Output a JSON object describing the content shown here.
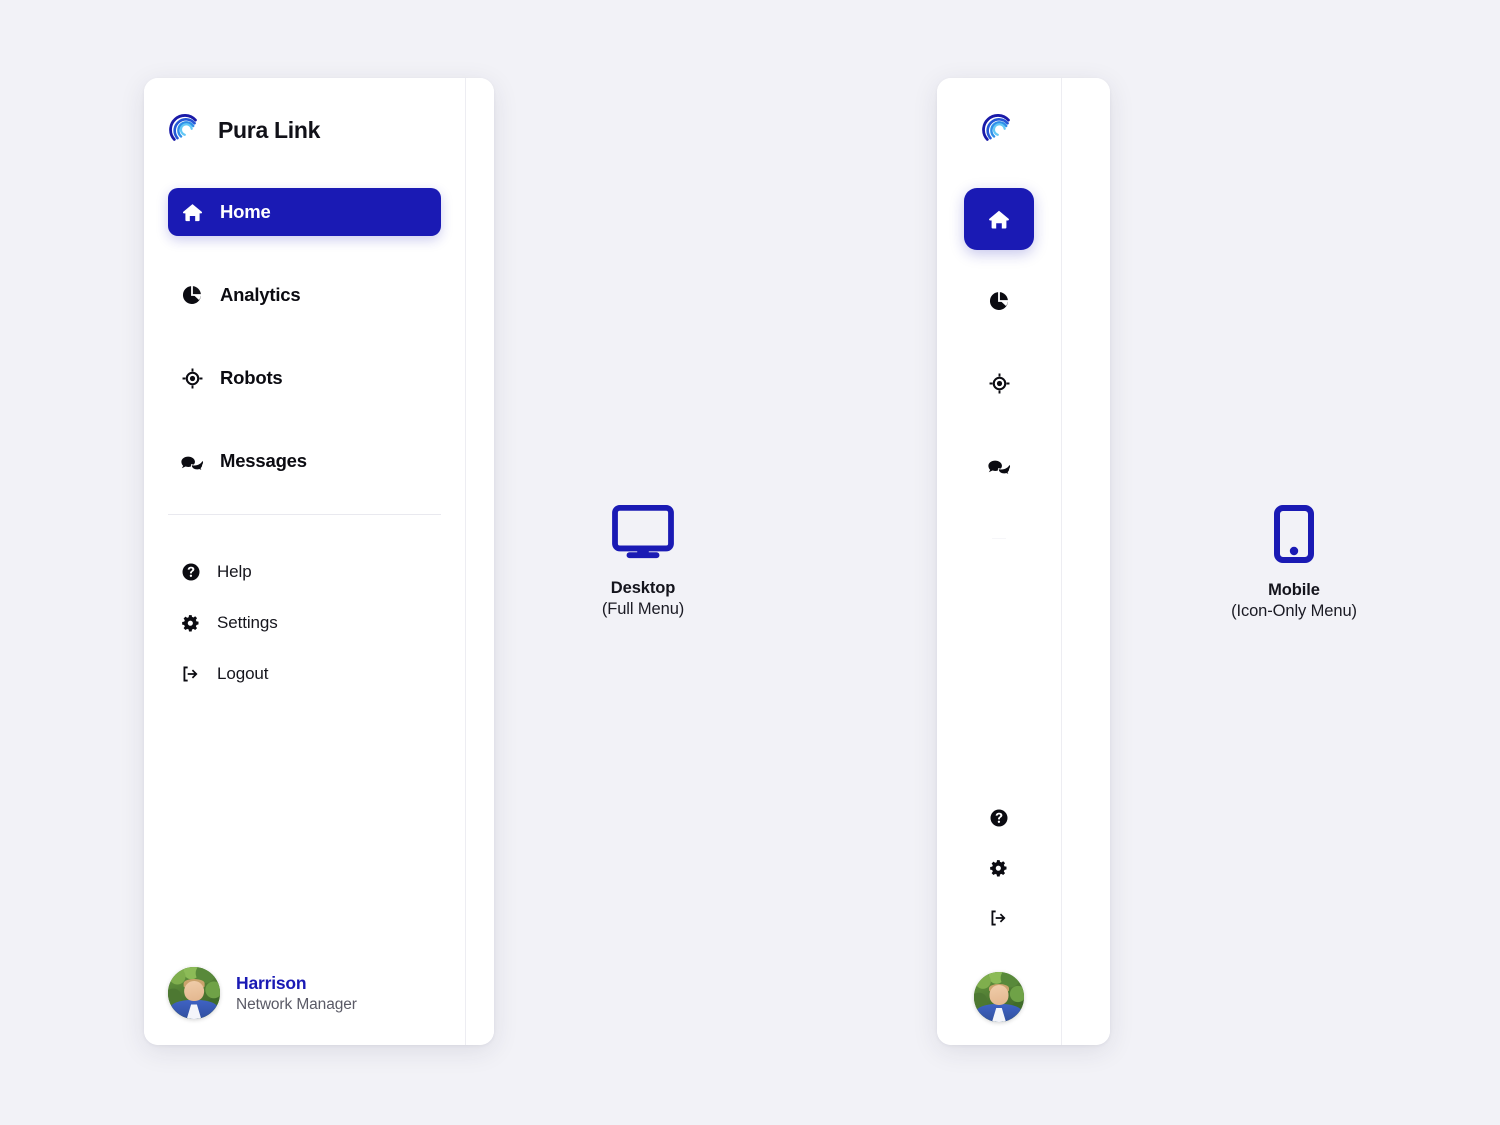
{
  "theme": {
    "page_background": "#f2f2f7",
    "card_background": "#ffffff",
    "accent": "#1a1ab4",
    "text_primary": "#0b0b11",
    "text_muted": "#5a5a66",
    "divider": "#e9e9ef"
  },
  "brand": {
    "name": "Pura Link",
    "logo_icon": "pura-link-arcs-logo"
  },
  "sidebar": {
    "primary_items": [
      {
        "id": "home",
        "label": "Home",
        "icon": "home-icon",
        "active": true
      },
      {
        "id": "analytics",
        "label": "Analytics",
        "icon": "pie-chart-icon",
        "active": false
      },
      {
        "id": "robots",
        "label": "Robots",
        "icon": "target-icon",
        "active": false
      },
      {
        "id": "messages",
        "label": "Messages",
        "icon": "chat-bubbles-icon",
        "active": false
      }
    ],
    "secondary_items": [
      {
        "id": "help",
        "label": "Help",
        "icon": "question-circle-icon"
      },
      {
        "id": "settings",
        "label": "Settings",
        "icon": "gear-icon"
      },
      {
        "id": "logout",
        "label": "Logout",
        "icon": "logout-icon"
      }
    ],
    "user": {
      "name": "Harrison",
      "role": "Network Manager",
      "avatar_icon": "user-avatar-photo"
    }
  },
  "devices": [
    {
      "id": "desktop",
      "glyph": "desktop-monitor-icon",
      "title": "Desktop",
      "subtitle": "(Full Menu)"
    },
    {
      "id": "mobile",
      "glyph": "mobile-phone-icon",
      "title": "Mobile",
      "subtitle": "(Icon-Only Menu)"
    }
  ]
}
